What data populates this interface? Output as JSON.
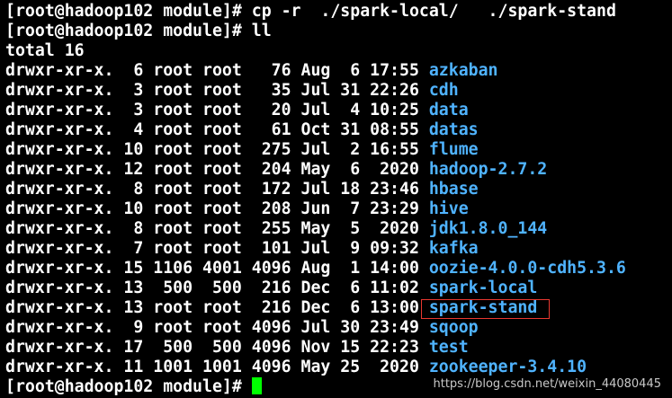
{
  "terminal": {
    "cmd1": {
      "prompt": "[root@hadoop102 module]# ",
      "command": "cp -r  ./spark-local/   ./spark-stand"
    },
    "cmd2": {
      "prompt": "[root@hadoop102 module]# ",
      "command": "ll"
    },
    "total": "total 16",
    "entries": [
      {
        "meta": "drwxr-xr-x.  6 root root   76 Aug  6 17:55 ",
        "name": "azkaban"
      },
      {
        "meta": "drwxr-xr-x.  3 root root   35 Jul 31 22:26 ",
        "name": "cdh"
      },
      {
        "meta": "drwxr-xr-x.  3 root root   20 Jul  4 10:25 ",
        "name": "data"
      },
      {
        "meta": "drwxr-xr-x.  4 root root   61 Oct 31 08:55 ",
        "name": "datas"
      },
      {
        "meta": "drwxr-xr-x. 10 root root  275 Jul  2 16:55 ",
        "name": "flume"
      },
      {
        "meta": "drwxr-xr-x. 12 root root  204 May  6  2020 ",
        "name": "hadoop-2.7.2"
      },
      {
        "meta": "drwxr-xr-x.  8 root root  172 Jul 18 23:46 ",
        "name": "hbase"
      },
      {
        "meta": "drwxr-xr-x. 10 root root  208 Jun  7 23:29 ",
        "name": "hive"
      },
      {
        "meta": "drwxr-xr-x.  8 root root  255 May  5  2020 ",
        "name": "jdk1.8.0_144"
      },
      {
        "meta": "drwxr-xr-x.  7 root root  101 Jul  9 09:32 ",
        "name": "kafka"
      },
      {
        "meta": "drwxr-xr-x. 15 1106 4001 4096 Aug  1 14:00 ",
        "name": "oozie-4.0.0-cdh5.3.6"
      },
      {
        "meta": "drwxr-xr-x. 13  500  500  216 Dec  6 11:02 ",
        "name": "spark-local"
      },
      {
        "meta": "drwxr-xr-x. 13 root root  216 Dec  6 13:00 ",
        "name": "spark-stand"
      },
      {
        "meta": "drwxr-xr-x.  9 root root 4096 Jul 30 23:49 ",
        "name": "sqoop"
      },
      {
        "meta": "drwxr-xr-x. 17  500  500 4096 Nov 15 22:23 ",
        "name": "test"
      },
      {
        "meta": "drwxr-xr-x. 11 1001 1001 4096 May 25  2020 ",
        "name": "zookeeper-3.4.10"
      }
    ],
    "final_prompt": "[root@hadoop102 module]# "
  },
  "watermark": "https://blog.csdn.net/weixin_44080445",
  "colors": {
    "background": "#000000",
    "text": "#ffffff",
    "directory": "#4fb3ff",
    "cursor": "#00ff00",
    "highlight_box": "#e8372f"
  }
}
